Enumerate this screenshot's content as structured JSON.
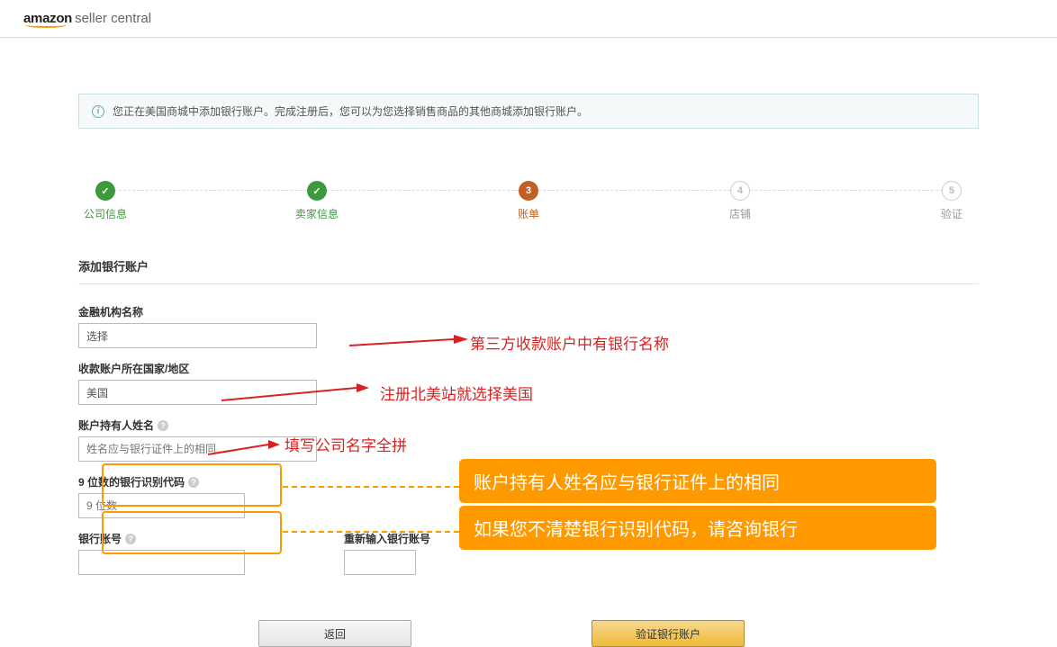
{
  "logo": {
    "main": "amazon",
    "sub": "seller central"
  },
  "info_bar": "您正在美国商城中添加银行账户。完成注册后，您可以为您选择销售商品的其他商城添加银行账户。",
  "steps": [
    {
      "num": "",
      "label": "公司信息",
      "state": "done"
    },
    {
      "num": "",
      "label": "卖家信息",
      "state": "done"
    },
    {
      "num": "3",
      "label": "账单",
      "state": "active"
    },
    {
      "num": "4",
      "label": "店铺",
      "state": "pending"
    },
    {
      "num": "5",
      "label": "验证",
      "state": "pending"
    }
  ],
  "section_title": "添加银行账户",
  "fields": {
    "institution": {
      "label": "金融机构名称",
      "value": "选择"
    },
    "country": {
      "label": "收款账户所在国家/地区",
      "value": "美国"
    },
    "holder": {
      "label": "账户持有人姓名",
      "placeholder": "姓名应与银行证件上的相同"
    },
    "routing": {
      "label": "9 位数的银行识别代码",
      "placeholder": "9 位数"
    },
    "acct": {
      "label": "银行账号"
    },
    "acct2": {
      "label": "重新输入银行账号"
    }
  },
  "annotations": {
    "a1": "第三方收款账户中有银行名称",
    "a2": "注册北美站就选择美国",
    "a3": "填写公司名字全拼",
    "box1": "账户持有人姓名应与银行证件上的相同",
    "box2": "如果您不清楚银行识别代码，请咨询银行"
  },
  "buttons": {
    "back": "返回",
    "verify": "验证银行账户"
  },
  "colors": {
    "accent": "#ff9900",
    "error_text": "#d92121"
  }
}
